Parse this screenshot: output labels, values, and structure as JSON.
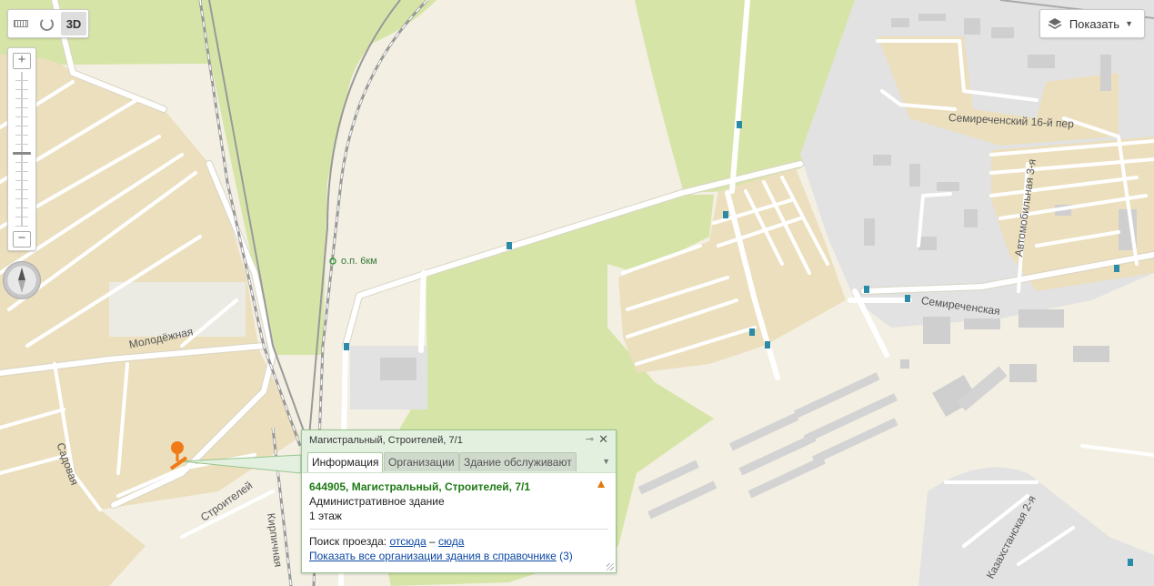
{
  "toolbar": {
    "ruler_icon": "ruler-icon",
    "route_icon": "route-icon",
    "mode_3d": "3D"
  },
  "zoom": {
    "plus": "+",
    "minus": "−",
    "level_fraction": 0.52
  },
  "layers": {
    "label": "Показать",
    "icon": "layers-icon"
  },
  "map": {
    "streets": {
      "molodezhnaya": "Молодёжная",
      "sadovaya": "Садовая",
      "stroiteley": "Строителей",
      "kirpichnaya": "Кирпичная",
      "semirechenskiy": "Семиреченский 16-й пер",
      "avtomobilnaya": "Автомобильная 3-я",
      "semirechenskaya": "Семиреченская",
      "kazakhstanskaya": "Казахстанская 2-я"
    },
    "station": "о.п. 6км"
  },
  "balloon": {
    "title": "Магистральный, Строителей, 7/1",
    "tabs": [
      "Информация",
      "Организации",
      "Здание обслуживают"
    ],
    "address": "644905, Магистральный, Строителей, 7/1",
    "type": "Административное здание",
    "floors": "1 этаж",
    "route_label": "Поиск проезда:",
    "route_from": "отсюда",
    "route_dash": "–",
    "route_to": "сюда",
    "show_all": "Показать все организации здания в справочнике",
    "show_all_count": "(3)"
  },
  "colors": {
    "land": "#f3efe3",
    "residential": "#ebdfbd",
    "green": "#d6e5a7",
    "industrial": "#e2e2e2",
    "road": "#ffffff",
    "marker": "#f07a18",
    "balloon_header": "#e3f0df",
    "address_green": "#1f7a14",
    "link": "#0b47a3"
  }
}
